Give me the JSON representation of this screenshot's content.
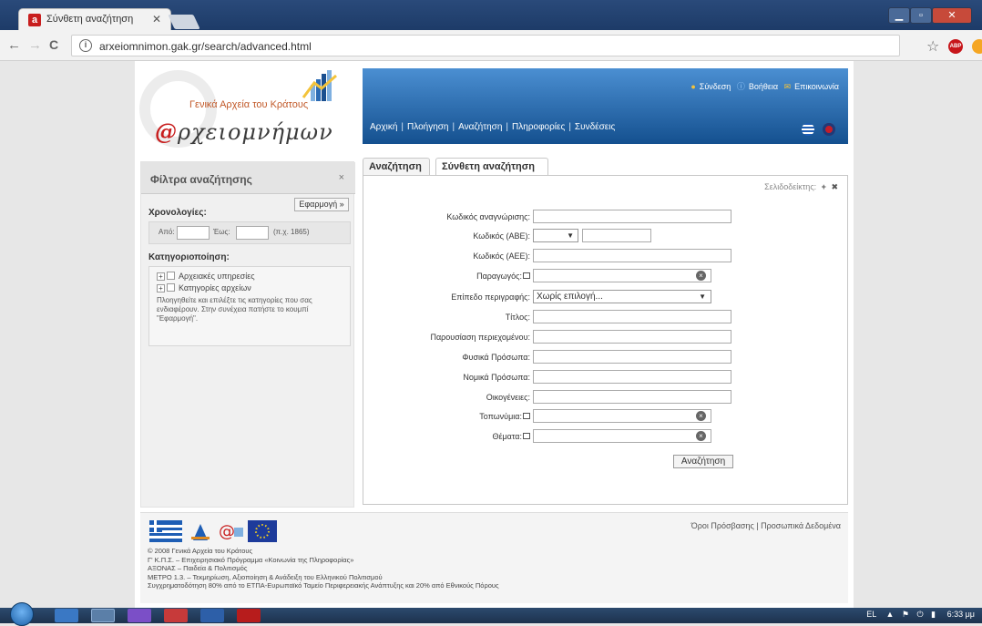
{
  "browser": {
    "tab_title": "Σύνθετη αναζήτηση",
    "tab_favicon": "a",
    "url": "arxeiomnimon.gak.gr/search/advanced.html",
    "back": "←",
    "forward": "→",
    "reload": "C",
    "star": "☆",
    "abp": "ABP",
    "close": "✕"
  },
  "logo": {
    "subtitle": "Γενικά Αρχεία του Κράτους",
    "at": "@",
    "name": "ρχειομνήμων"
  },
  "header": {
    "toplinks": [
      "Σύνδεση",
      "Βοήθεια",
      "Επικοινωνία"
    ],
    "nav": [
      "Αρχική",
      "Πλοήγηση",
      "Αναζήτηση",
      "Πληροφορίες",
      "Συνδέσεις"
    ],
    "separator": "|"
  },
  "sidebar": {
    "title": "Φίλτρα αναζήτησης",
    "close": "×",
    "apply": "Εφαρμογή »",
    "chronology_label": "Χρονολογίες:",
    "from_label": "Από:",
    "to_label": "Έως:",
    "example": "(π.χ. 1865)",
    "categorization_label": "Κατηγοριοποίηση:",
    "categories": [
      "Αρχειακές υπηρεσίες",
      "Κατηγορίες αρχείων"
    ],
    "help": "Πλοηγηθείτε και επιλέξτε τις κατηγορίες που σας ενδιαφέρουν. Στην συνέχεια πατήστε το κουμπί \"Εφαρμογή\"."
  },
  "tabs": [
    "Αναζήτηση",
    "Σύνθετη αναζήτηση"
  ],
  "form": {
    "bookmark": "Σελιδοδείκτης:",
    "bookmark_add": "+",
    "bookmark_remove": "✖",
    "fields": {
      "id": "Κωδικός αναγνώρισης:",
      "abe": "Κωδικός (ΑΒΕ):",
      "aee": "Κωδικός (ΑΕΕ):",
      "producer": "Παραγωγός:",
      "level": "Επίπεδο περιγραφής:",
      "title": "Τίτλος:",
      "content": "Παρουσίαση περιεχομένου:",
      "persons": "Φυσικά Πρόσωπα:",
      "legal": "Νομικά Πρόσωπα:",
      "families": "Οικογένειες:",
      "places": "Τοπωνύμια:",
      "subjects": "Θέματα:"
    },
    "level_value": "Χωρίς επιλογή...",
    "search_button": "Αναζήτηση"
  },
  "footer": {
    "links": "Όροι Πρόσβασης | Προσωπικά Δεδομένα",
    "lines": [
      "© 2008 Γενικά Αρχεία του Κράτους",
      "Γ' Κ.Π.Σ. – Επιχειρησιακό Πρόγραμμα «Κοινωνία της Πληροφορίας»",
      "ΑΞΟΝΑΣ – Παιδεία & Πολιτισμός",
      "ΜΕΤΡΟ 1.3. – Τεκμηρίωση, Αξιοποίηση & Ανάδειξη του Ελληνικού Πολιτισμού",
      "Συγχρηματοδότηση 80% από το ΕΤΠΑ-Ευρωπαϊκό Ταμείο Περιφερειακής Ανάπτυξης και 20% από Εθνικούς Πόρους"
    ]
  },
  "taskbar": {
    "lang": "EL",
    "time": "6:33 μμ"
  },
  "colors": {
    "header_top": "#4b8fd2",
    "header_bottom": "#14508f",
    "logo_red": "#c81e1e"
  },
  "icons": [
    "user-icon",
    "help-icon",
    "mail-icon",
    "clear-icon",
    "popup-icon",
    "flag-gr-icon",
    "flag-uk-icon"
  ]
}
